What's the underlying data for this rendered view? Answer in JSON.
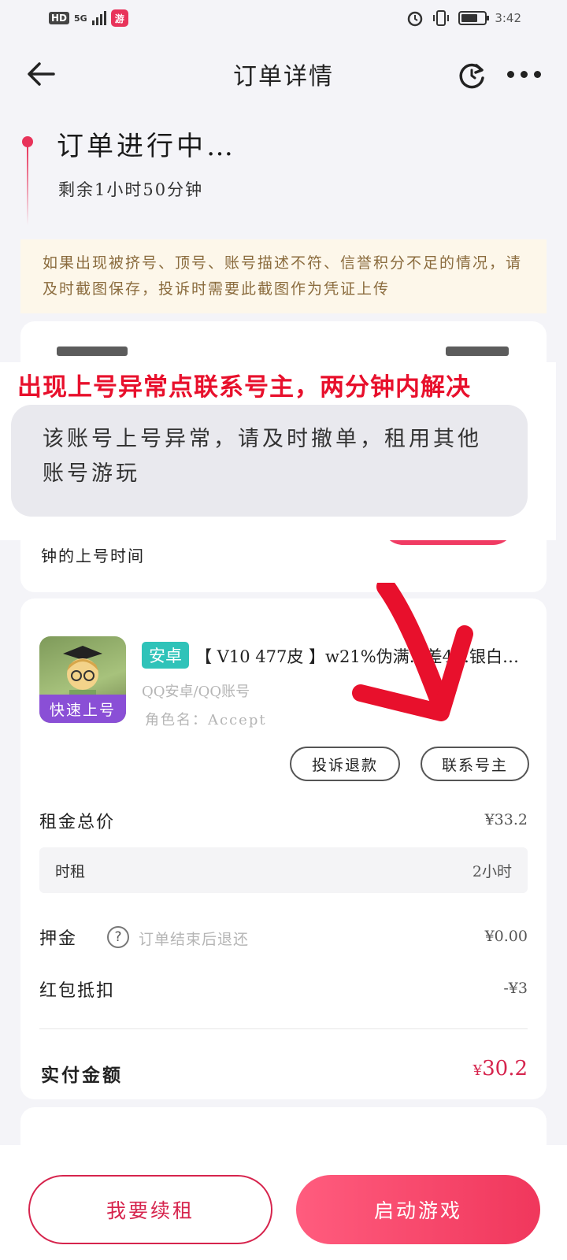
{
  "status_bar": {
    "hd": "HD",
    "network": "5G",
    "time": "3:42",
    "app_badge": "游"
  },
  "header": {
    "title": "订单详情"
  },
  "order_status": {
    "title": "订单进行中…",
    "remaining": "剩余1小时50分钟"
  },
  "notice": {
    "text": "如果出现被挤号、顶号、账号描述不符、信誉积分不足的情况，请及时截图保存，投诉时需要此截图作为凭证上传"
  },
  "card1": {
    "partial_text": "钟的上号时间"
  },
  "overlay": {
    "headline": "出现上号异常点联系号主，两分钟内解决",
    "toast": "该账号上号异常，请及时撤单，租用其他账号游玩"
  },
  "product": {
    "thumb_tag": "快速上号",
    "platform": "安卓",
    "title": "【 V10 477皮 】w21%伪满…差4…银白%…",
    "account_type": "QQ安卓/QQ账号",
    "role_name": "角色名：Accept",
    "complain_button": "投诉退款",
    "contact_button": "联系号主"
  },
  "pricing": {
    "total_label": "租金总价",
    "total_value": "¥33.2",
    "sub_label": "时租",
    "sub_value": "2小时",
    "deposit_label": "押金",
    "deposit_note": "订单结束后退还",
    "deposit_value": "¥0.00",
    "redpack_label": "红包抵扣",
    "redpack_value": "-¥3",
    "paid_label": "实付金额",
    "paid_currency": "¥",
    "paid_value": "30.2"
  },
  "bottom": {
    "renew_button": "我要续租",
    "start_button": "启动游戏"
  },
  "colors": {
    "accent": "#e8335a",
    "overlay_headline": "#e8102c",
    "platform_badge": "#2fc3b9",
    "thumb_tag": "#8a4fd6"
  }
}
